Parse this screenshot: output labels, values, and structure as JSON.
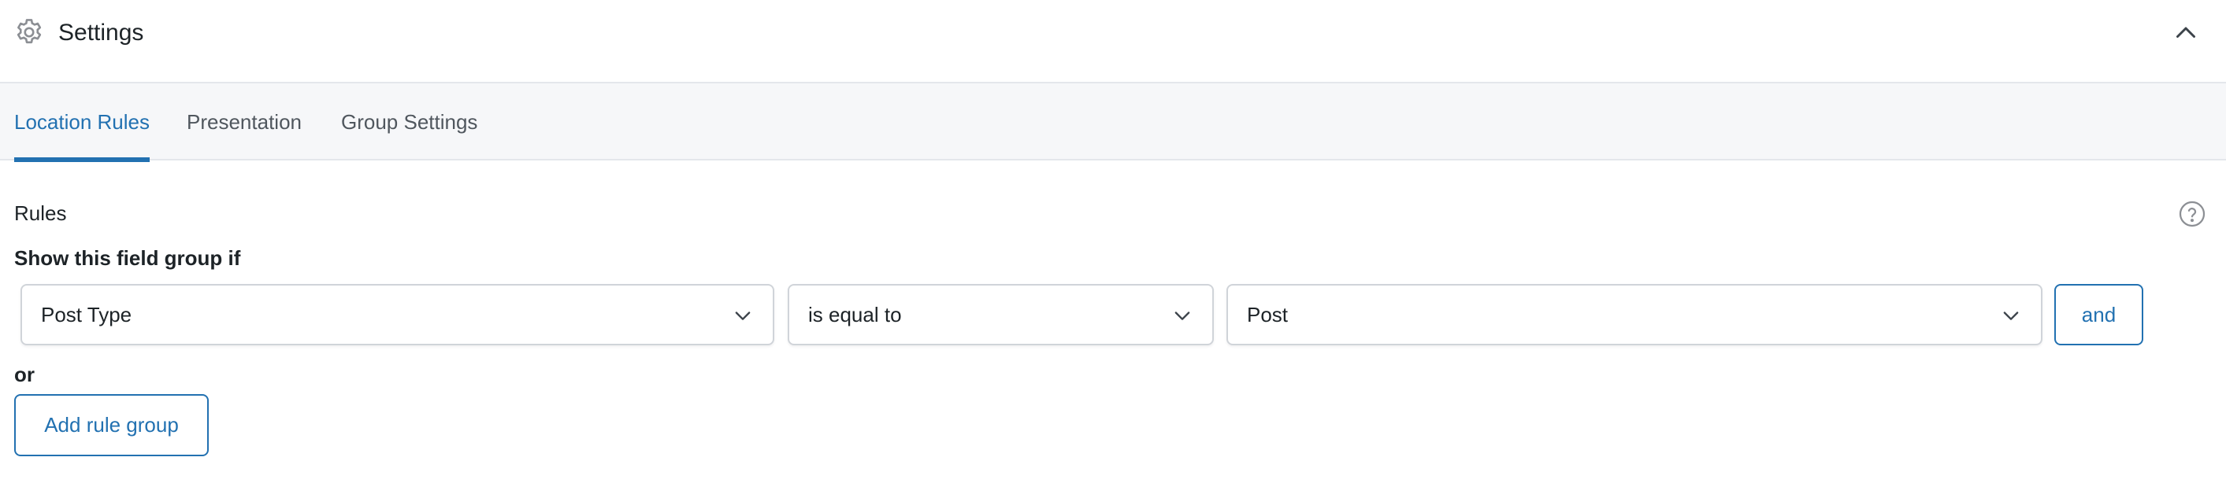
{
  "panel": {
    "title": "Settings",
    "icons": {
      "settings": "gear-icon",
      "collapse": "chevron-up-icon"
    }
  },
  "tabs": [
    {
      "label": "Location Rules",
      "active": true
    },
    {
      "label": "Presentation",
      "active": false
    },
    {
      "label": "Group Settings",
      "active": false
    }
  ],
  "rules": {
    "section_label": "Rules",
    "help_icon": "help-icon",
    "show_if_label": "Show this field group if",
    "rule": {
      "param": "Post Type",
      "operator": "is equal to",
      "value": "Post"
    },
    "and_label": "and",
    "or_label": "or",
    "add_group_label": "Add rule group"
  },
  "colors": {
    "accent": "#2271b1",
    "text": "#1d2327",
    "muted": "#50575e",
    "tabs_background": "#f6f7f9",
    "border": "#d0d4d9"
  }
}
